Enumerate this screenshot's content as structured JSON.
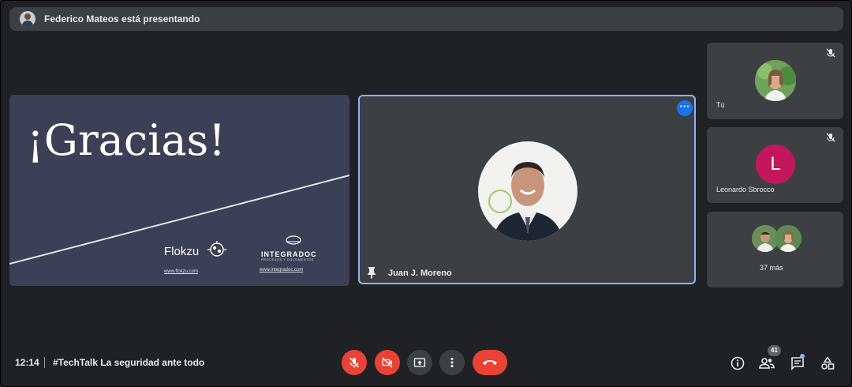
{
  "banner": {
    "text": "Federico Mateos está presentando",
    "avatar_icon": "presenter-avatar"
  },
  "slide": {
    "title": "¡Gracias!",
    "logo_flokzu": "Flokzu",
    "logo_integradoc": "INTEGRADOC",
    "logo_integradoc_sub": "PROCESOS Y DOCUMENTOS",
    "url_flokzu": "www.flokzu.com",
    "url_integradoc": "www.integradoc.com",
    "background_color": "#3b4057"
  },
  "main_tile": {
    "name": "Juan J. Moreno",
    "more_icon": "more-options-icon",
    "pin_icon": "pin-icon",
    "highlight_color": "#8ab4f8"
  },
  "side_tiles": [
    {
      "label": "Tú",
      "mic_icon": "mic-off-icon"
    },
    {
      "label": "Leonardo Sbrocco",
      "initial": "L",
      "avatar_color": "#c2185b",
      "mic_icon": "mic-off-icon"
    },
    {
      "label": "37 más"
    }
  ],
  "bottom_bar": {
    "time": "12:14",
    "meeting_title": "#TechTalk La seguridad ante todo",
    "controls": [
      "mic-off-icon",
      "camera-off-icon",
      "present-screen-icon",
      "more-options-icon",
      "end-call-icon"
    ],
    "right_icons": [
      "info-icon",
      "people-icon",
      "chat-icon",
      "activities-icon"
    ],
    "people_count": "41",
    "danger_color": "#ea4335"
  }
}
